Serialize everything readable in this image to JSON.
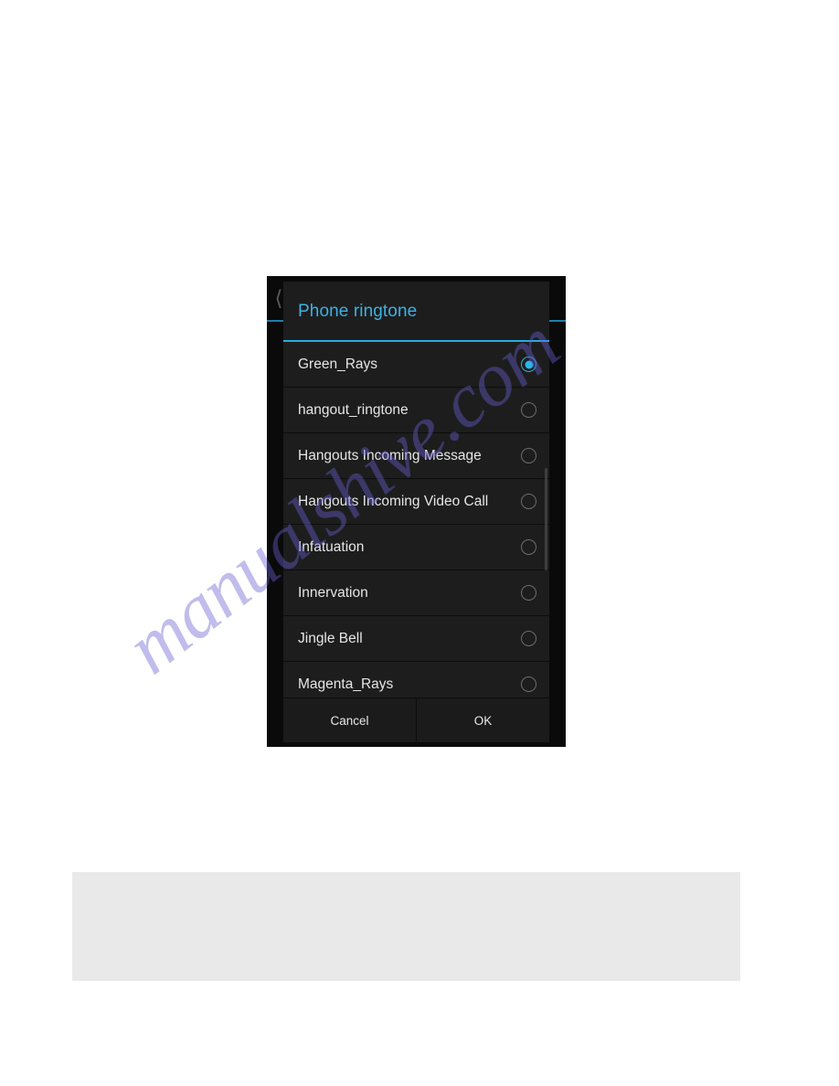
{
  "page": {
    "background_color": "#ffffff",
    "watermark_text": "manualshive.com",
    "watermark_color": "#6860d2"
  },
  "phone": {
    "frame_color": "#000000",
    "background_screen_color": "#0a0a0a",
    "back_icon": "chevron-left-icon",
    "accent_color": "#2aaae0"
  },
  "dialog": {
    "title": "Phone ringtone",
    "title_color": "#3db2e3",
    "background_color": "#1b1b1b",
    "row_background_color": "#1d1d1d",
    "divider_color": "#0d0d0d",
    "selected_index": 0,
    "items": [
      {
        "label": "Green_Rays",
        "selected": true
      },
      {
        "label": "hangout_ringtone",
        "selected": false
      },
      {
        "label": "Hangouts Incoming Message",
        "selected": false
      },
      {
        "label": "Hangouts Incoming Video Call",
        "selected": false
      },
      {
        "label": "Infatuation",
        "selected": false
      },
      {
        "label": "Innervation",
        "selected": false
      },
      {
        "label": "Jingle Bell",
        "selected": false
      },
      {
        "label": "Magenta_Rays",
        "selected": false
      }
    ],
    "buttons": {
      "cancel_label": "Cancel",
      "ok_label": "OK"
    }
  },
  "gray_box": {
    "color": "#e9e9e9",
    "text": ""
  }
}
